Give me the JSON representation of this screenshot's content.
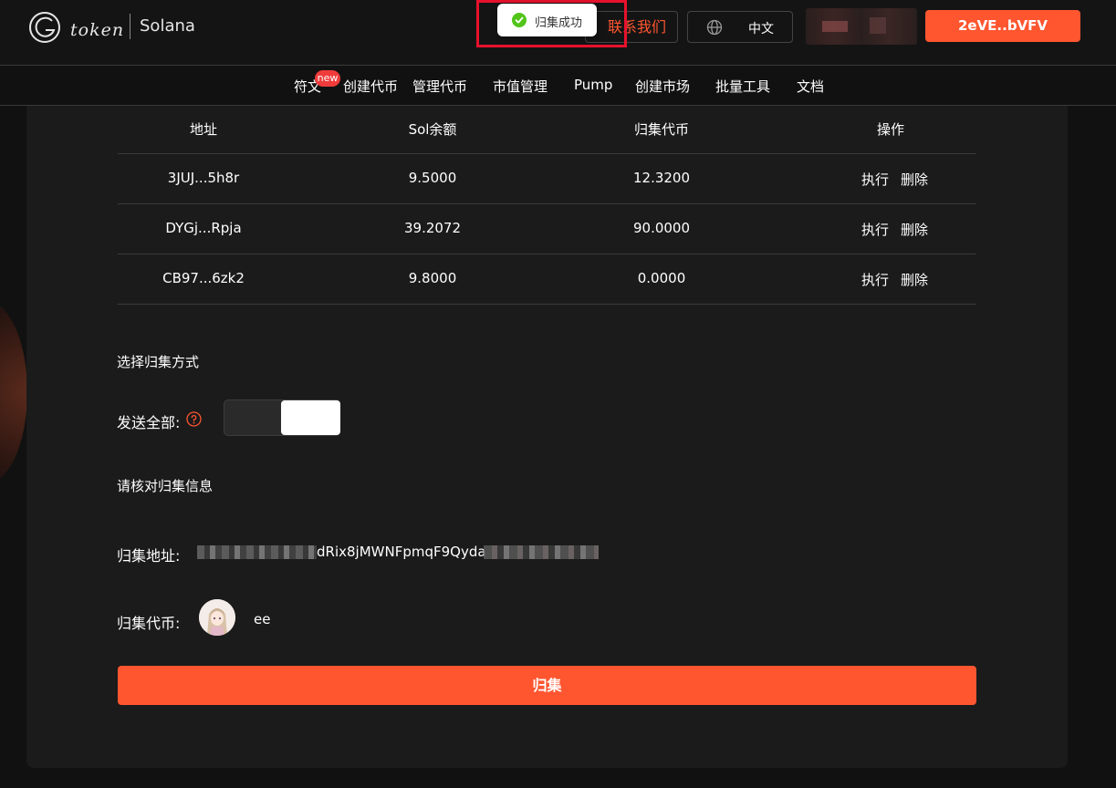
{
  "header": {
    "logo_text": "token",
    "chain": "Solana",
    "contact_label": "联系我们",
    "lang_label": "中文",
    "wallet_label": "2eVE..bVFV"
  },
  "toast": {
    "text": "归集成功"
  },
  "nav": {
    "badge": "new",
    "items": [
      "符文",
      "创建代币",
      "管理代币",
      "市值管理",
      "Pump",
      "创建市场",
      "批量工具",
      "文档"
    ]
  },
  "table": {
    "headers": [
      "地址",
      "Sol余额",
      "归集代币",
      "操作"
    ],
    "rows": [
      {
        "address": "3JUJ...5h8r",
        "sol": "9.5000",
        "token": "12.3200",
        "exec": "执行",
        "delete": "删除"
      },
      {
        "address": "DYGj...Rpja",
        "sol": "39.2072",
        "token": "90.0000",
        "exec": "执行",
        "delete": "删除"
      },
      {
        "address": "CB97...6zk2",
        "sol": "9.8000",
        "token": "0.0000",
        "exec": "执行",
        "delete": "删除"
      }
    ]
  },
  "form": {
    "method_title": "选择归集方式",
    "send_all_label": "发送全部:",
    "verify_title": "请核对归集信息",
    "address_label": "归集地址:",
    "address_visible": "dRix8jMWNFpmqF9Qyda",
    "token_label": "归集代币:",
    "token_name": "ee",
    "submit_label": "归集"
  },
  "colors": {
    "accent": "#ff5630",
    "toast_outline": "#e8112d",
    "success": "#52c41a"
  }
}
